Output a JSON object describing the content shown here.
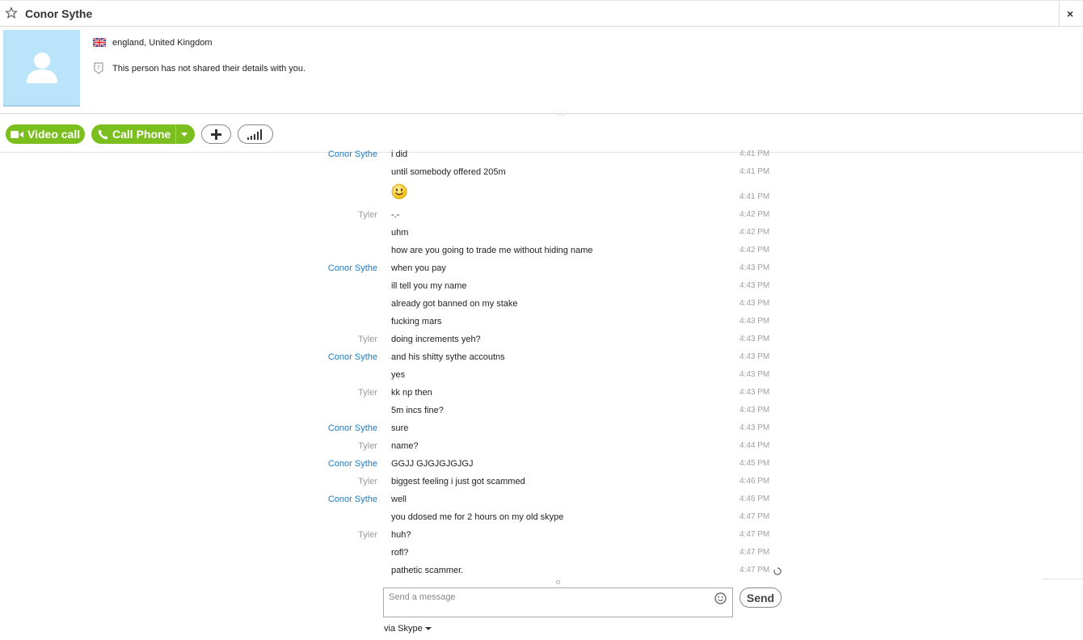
{
  "window": {
    "title": "Conor Sythe",
    "close_label": "×"
  },
  "profile": {
    "location": "england, United Kingdom",
    "info": "This person has not shared their details with you."
  },
  "toolbar": {
    "video_call_label": "Video call",
    "call_phone_label": "Call Phone",
    "accent_color": "#7bbf1f"
  },
  "messages": [
    {
      "sender": "Conor Sythe",
      "text": "i did",
      "time": "4:41 PM"
    },
    {
      "sender": "",
      "text": "until somebody offered 205m",
      "time": "4:41 PM"
    },
    {
      "sender": "",
      "text": "",
      "emoji": "smile-emoji",
      "time": "4:41 PM"
    },
    {
      "sender": "Tyler",
      "text": "-.-",
      "time": "4:42 PM"
    },
    {
      "sender": "",
      "text": "uhm",
      "time": "4:42 PM"
    },
    {
      "sender": "",
      "text": "how are you going to trade me without hiding name",
      "time": "4:42 PM"
    },
    {
      "sender": "Conor Sythe",
      "text": "when you pay",
      "time": "4:43 PM"
    },
    {
      "sender": "",
      "text": "ill tell you my name",
      "time": "4:43 PM"
    },
    {
      "sender": "",
      "text": "already got banned on my stake",
      "time": "4:43 PM"
    },
    {
      "sender": "",
      "text": "fucking mars",
      "time": "4:43 PM"
    },
    {
      "sender": "Tyler",
      "text": "doing increments yeh?",
      "time": "4:43 PM"
    },
    {
      "sender": "Conor Sythe",
      "text": "and his shitty sythe accoutns",
      "time": "4:43 PM"
    },
    {
      "sender": "",
      "text": "yes",
      "time": "4:43 PM"
    },
    {
      "sender": "Tyler",
      "text": "kk np then",
      "time": "4:43 PM"
    },
    {
      "sender": "",
      "text": "5m incs fine?",
      "time": "4:43 PM"
    },
    {
      "sender": "Conor Sythe",
      "text": "sure",
      "time": "4:43 PM"
    },
    {
      "sender": "Tyler",
      "text": "name?",
      "time": "4:44 PM"
    },
    {
      "sender": "Conor Sythe",
      "text": "GGJJ GJGJGJGJGJ",
      "time": "4:45 PM"
    },
    {
      "sender": "Tyler",
      "text": "biggest feeling i just got scammed",
      "time": "4:46 PM"
    },
    {
      "sender": "Conor Sythe",
      "text": "well",
      "time": "4:46 PM"
    },
    {
      "sender": "",
      "text": "you ddosed me for 2 hours on my old skype",
      "time": "4:47 PM"
    },
    {
      "sender": "Tyler",
      "text": "huh?",
      "time": "4:47 PM"
    },
    {
      "sender": "",
      "text": "rofl?",
      "time": "4:47 PM"
    },
    {
      "sender": "",
      "text": "pathetic scammer.",
      "time": "4:47 PM",
      "pending": true
    }
  ],
  "composer": {
    "placeholder": "Send a message",
    "value": "",
    "send_label": "Send",
    "via_label": "via Skype"
  },
  "colors": {
    "conor_name": "#1e7bc2",
    "tyler_name": "#999999",
    "avatar_bg": "#b9e4fa"
  }
}
